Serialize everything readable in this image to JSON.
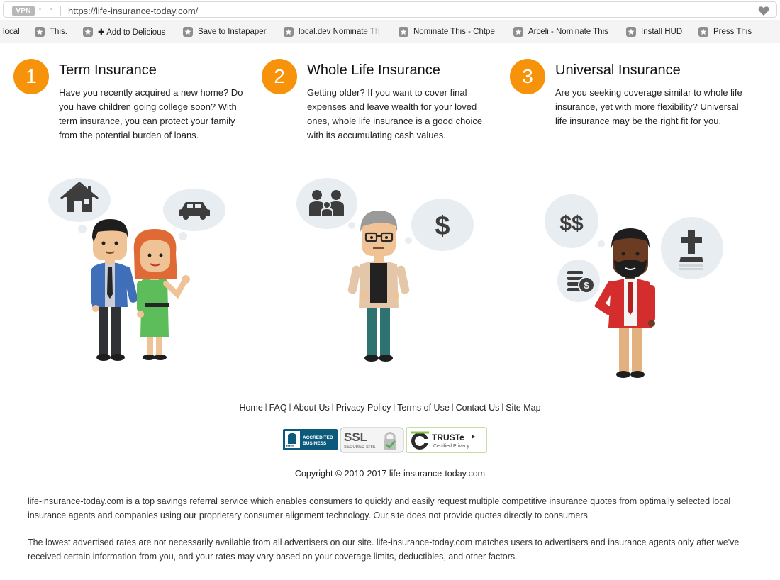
{
  "browser": {
    "vpn_label": "VPN",
    "url": "https://life-insurance-today.com/"
  },
  "bookmarks": [
    {
      "label": "local"
    },
    {
      "label": "This."
    },
    {
      "label": "✚ Add to Delicious"
    },
    {
      "label": "Save to Instapaper"
    },
    {
      "label": "local.dev Nominate Th"
    },
    {
      "label": "Nominate This - Chtpe"
    },
    {
      "label": "Arceli - Nominate This"
    },
    {
      "label": "Install HUD"
    },
    {
      "label": "Press This"
    }
  ],
  "features": [
    {
      "number": "1",
      "title": "Term Insurance",
      "body": "Have you recently acquired a new home? Do you have children going college soon? With term insurance, you can protect your family from the potential burden of loans."
    },
    {
      "number": "2",
      "title": "Whole Life Insurance",
      "body": "Getting older? If you want to cover final expenses and leave wealth for your loved ones, whole life insurance is a good choice with its accumulating cash values."
    },
    {
      "number": "3",
      "title": "Universal Insurance",
      "body": "Are you seeking coverage similar to whole life insurance, yet with more flexibility? Universal life insurance may be the right fit for you."
    }
  ],
  "illustrations": {
    "dollar": "$",
    "double_dollar": "$$"
  },
  "footer": {
    "nav": [
      "Home",
      "FAQ",
      "About Us",
      "Privacy Policy",
      "Terms of Use",
      "Contact Us",
      "Site Map"
    ],
    "separator": "l",
    "badges": {
      "bbb_main": "ACCREDITED",
      "bbb_sub": "BUSINESS",
      "bbb_logo": "BBB.",
      "ssl_main": "SSL",
      "ssl_sub": "SECURED SITE",
      "truste_main": "TRUSTe",
      "truste_sub": "Certified Privacy"
    },
    "copyright": "Copyright © 2010-2017 life-insurance-today.com",
    "disclaimer_1": "life-insurance-today.com is a top savings referral service which enables consumers to quickly and easily request multiple competitive insurance quotes from optimally selected local insurance agents and companies using our proprietary consumer alignment technology. Our site does not provide quotes directly to consumers.",
    "disclaimer_2": "The lowest advertised rates are not necessarily available from all advertisers on our site. life-insurance-today.com matches users to advertisers and insurance agents only after we've received certain information from you, and your rates may vary based on your coverage limits, deductibles, and other factors."
  },
  "colors": {
    "accent": "#f7930a",
    "bubble": "#e8edf2",
    "icon": "#3d3d3d"
  }
}
